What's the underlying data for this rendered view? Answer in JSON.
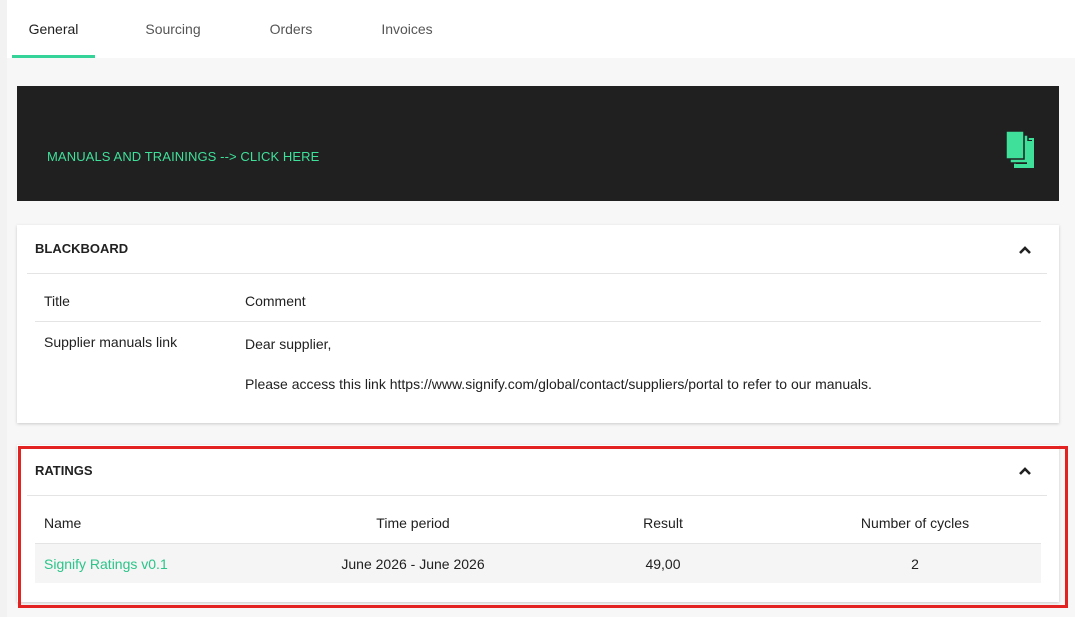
{
  "tabs": [
    {
      "label": "General",
      "active": true
    },
    {
      "label": "Sourcing",
      "active": false
    },
    {
      "label": "Orders",
      "active": false
    },
    {
      "label": "Invoices",
      "active": false
    }
  ],
  "banner": {
    "text": "MANUALS AND TRAININGS --> CLICK HERE",
    "icon": "documents-icon"
  },
  "blackboard": {
    "title": "BLACKBOARD",
    "columns": [
      "Title",
      "Comment"
    ],
    "rows": [
      {
        "title": "Supplier manuals link",
        "comment_line1": "Dear supplier,",
        "comment_line2": "Please access this link https://www.signify.com/global/contact/suppliers/portal to refer to our manuals."
      }
    ]
  },
  "ratings": {
    "title": "RATINGS",
    "columns": [
      "Name",
      "Time period",
      "Result",
      "Number of cycles"
    ],
    "rows": [
      {
        "name": "Signify Ratings v0.1",
        "time_period": "June 2026 - June 2026",
        "result": "49,00",
        "cycles": "2"
      }
    ]
  },
  "colors": {
    "accent": "#35d39a",
    "banner_bg": "#202020",
    "highlight_frame": "#e32222"
  }
}
